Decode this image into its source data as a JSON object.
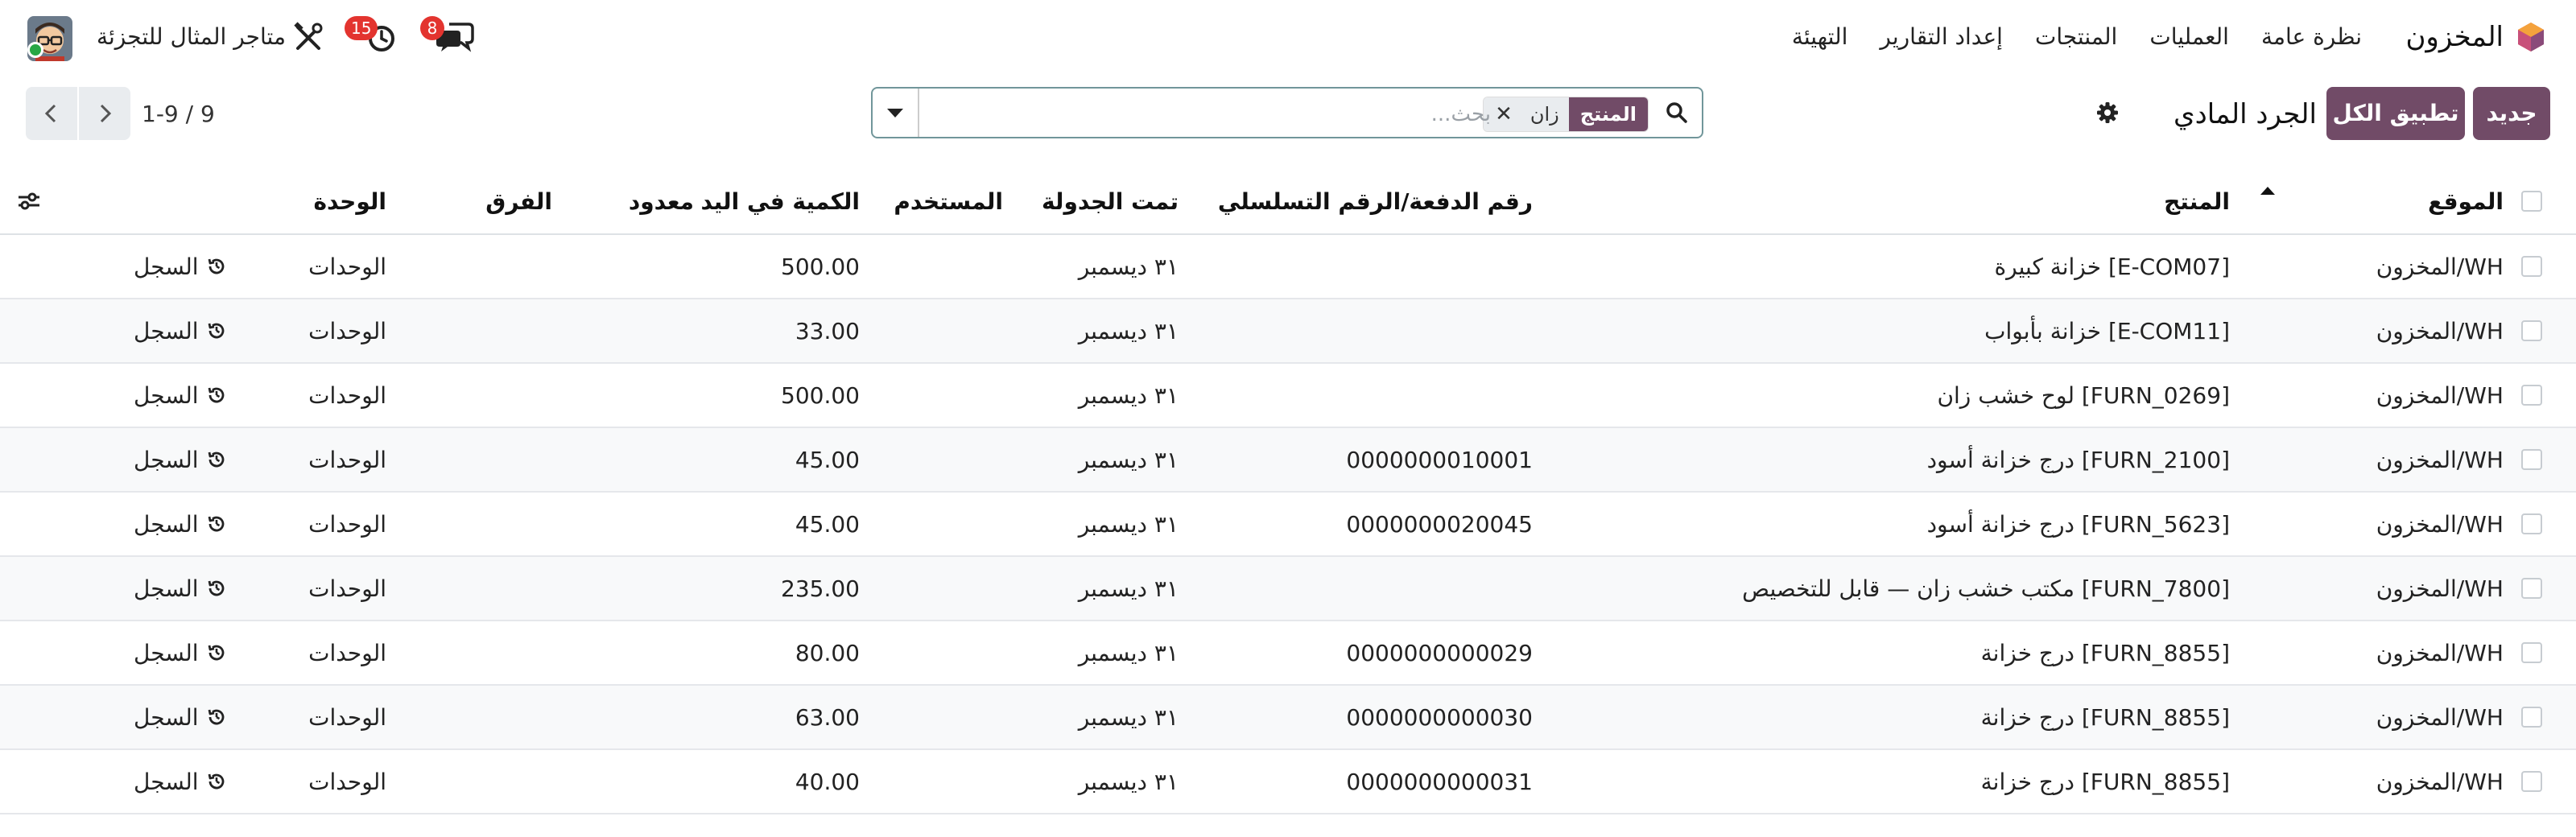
{
  "navbar": {
    "app_title": "المخزون",
    "menus": [
      "نظرة عامة",
      "العمليات",
      "المنتجات",
      "إعداد التقارير",
      "التهيئة"
    ],
    "company": "متاجر المثال للتجزئة",
    "activity_badge": "15",
    "chat_badge": "8"
  },
  "control_panel": {
    "new_label": "جديد",
    "apply_all_label": "تطبيق الكل",
    "title": "الجرد المادي",
    "search": {
      "facet_label": "المنتج",
      "facet_value": "زان",
      "placeholder": "بحث..."
    },
    "pager": "1-9 / 9"
  },
  "table": {
    "headers": {
      "location": "الموقع",
      "product": "المنتج",
      "lot": "رقم الدفعة/الرقم التسلسلي",
      "scheduled": "تمت الجدولة",
      "user": "المستخدم",
      "qty": "الكمية في اليد",
      "counted": "معدود",
      "difference": "الفرق",
      "uom": "الوحدة"
    },
    "rows": [
      {
        "location": "WH/المخزون",
        "product": "[E-COM07] خزانة كبيرة",
        "lot": "",
        "scheduled": "٣١ ديسمبر",
        "user": "",
        "qty": "500.00",
        "counted": "",
        "difference": "",
        "uom": "الوحدات",
        "history": "السجل"
      },
      {
        "location": "WH/المخزون",
        "product": "[E-COM11] خزانة بأبواب",
        "lot": "",
        "scheduled": "٣١ ديسمبر",
        "user": "",
        "qty": "33.00",
        "counted": "",
        "difference": "",
        "uom": "الوحدات",
        "history": "السجل"
      },
      {
        "location": "WH/المخزون",
        "product": "[FURN_0269] لوح خشب زان",
        "lot": "",
        "scheduled": "٣١ ديسمبر",
        "user": "",
        "qty": "500.00",
        "counted": "",
        "difference": "",
        "uom": "الوحدات",
        "history": "السجل"
      },
      {
        "location": "WH/المخزون",
        "product": "[FURN_2100] درج خزانة أسود",
        "lot": "0000000010001",
        "scheduled": "٣١ ديسمبر",
        "user": "",
        "qty": "45.00",
        "counted": "",
        "difference": "",
        "uom": "الوحدات",
        "history": "السجل"
      },
      {
        "location": "WH/المخزون",
        "product": "[FURN_5623] درج خزانة أسود",
        "lot": "0000000020045",
        "scheduled": "٣١ ديسمبر",
        "user": "",
        "qty": "45.00",
        "counted": "",
        "difference": "",
        "uom": "الوحدات",
        "history": "السجل"
      },
      {
        "location": "WH/المخزون",
        "product": "[FURN_7800] مكتب خشب زان — قابل للتخصيص",
        "lot": "",
        "scheduled": "٣١ ديسمبر",
        "user": "",
        "qty": "235.00",
        "counted": "",
        "difference": "",
        "uom": "الوحدات",
        "history": "السجل"
      },
      {
        "location": "WH/المخزون",
        "product": "[FURN_8855] درج خزانة",
        "lot": "0000000000029",
        "scheduled": "٣١ ديسمبر",
        "user": "",
        "qty": "80.00",
        "counted": "",
        "difference": "",
        "uom": "الوحدات",
        "history": "السجل"
      },
      {
        "location": "WH/المخزون",
        "product": "[FURN_8855] درج خزانة",
        "lot": "0000000000030",
        "scheduled": "٣١ ديسمبر",
        "user": "",
        "qty": "63.00",
        "counted": "",
        "difference": "",
        "uom": "الوحدات",
        "history": "السجل"
      },
      {
        "location": "WH/المخزون",
        "product": "[FURN_8855] درج خزانة",
        "lot": "0000000000031",
        "scheduled": "٣١ ديسمبر",
        "user": "",
        "qty": "40.00",
        "counted": "",
        "difference": "",
        "uom": "الوحدات",
        "history": "السجل"
      }
    ]
  },
  "colors": {
    "brand": "#714b67",
    "badge": "#e3342f",
    "status_online": "#28a745",
    "search_border": "#71969a"
  },
  "icons": [
    "app-logo-icon",
    "tools-icon",
    "activity-clock-icon",
    "chat-icon",
    "gear-icon",
    "search-icon",
    "chevron-left-icon",
    "chevron-right-icon",
    "history-icon",
    "column-settings-icon"
  ]
}
